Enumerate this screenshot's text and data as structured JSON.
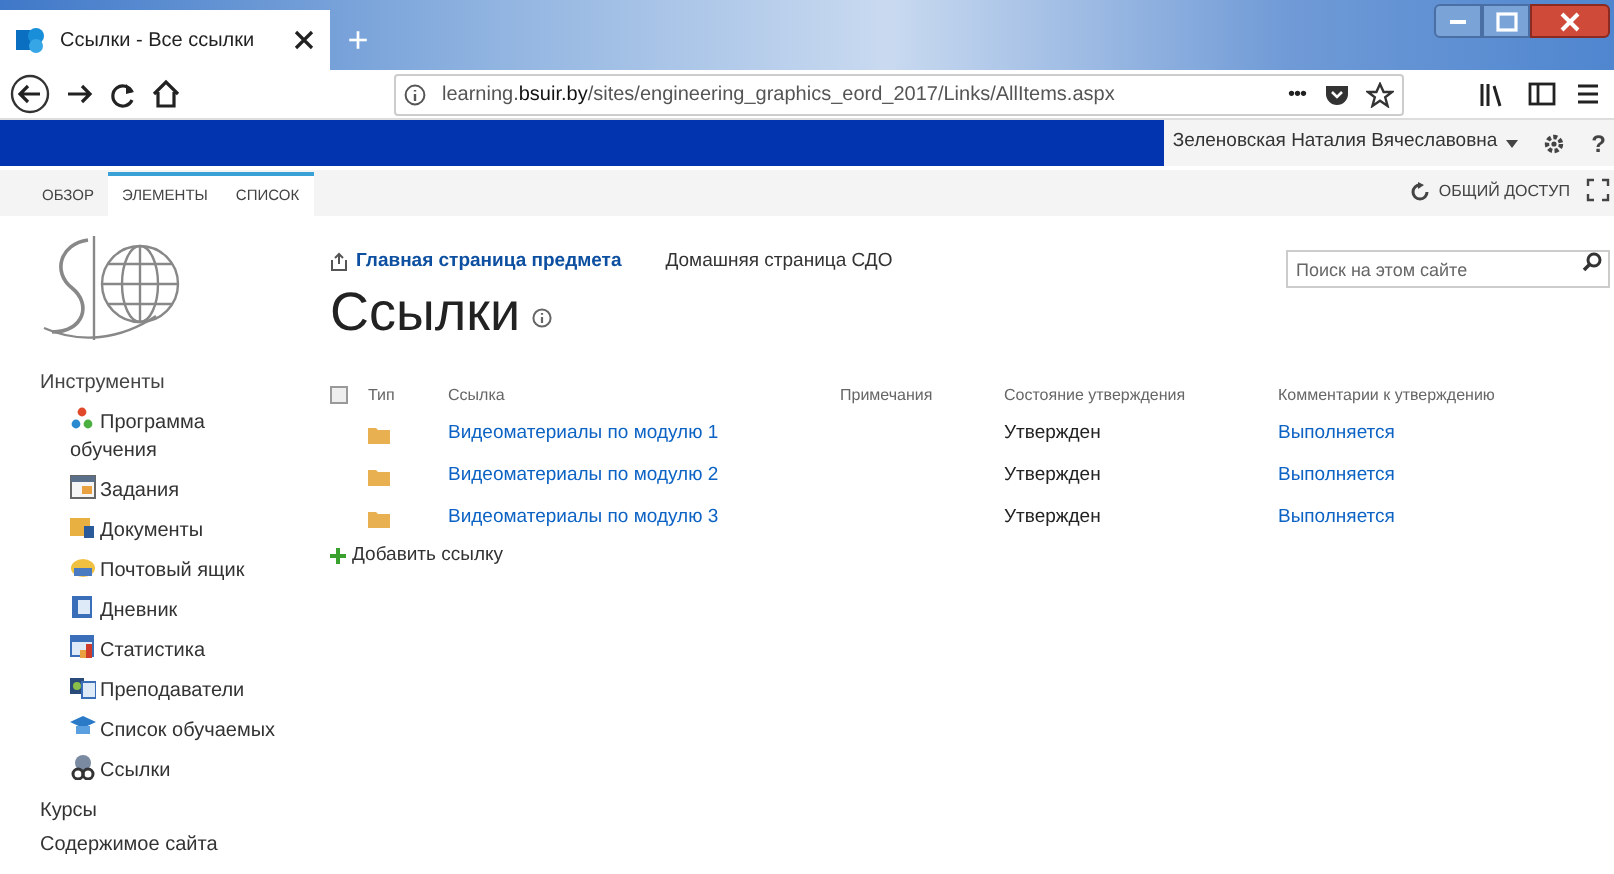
{
  "browser": {
    "tabs": [
      {
        "title": "Ссылки - Все ссылки",
        "selected": true
      }
    ],
    "new_tab": "+",
    "url_prefix": "learning.",
    "url_domain": "bsuir.by",
    "url_path": "/sites/engineering_graphics_eord_2017/Links/AllItems.aspx",
    "page_actions": "•••"
  },
  "suite_bar": {
    "user": "Зеленовская Наталия Вячеславовна",
    "help": "?"
  },
  "ribbon": {
    "tabs": [
      {
        "label": "ОБЗОР",
        "selected": false,
        "contextual": false
      },
      {
        "label": "ЭЛЕМЕНТЫ",
        "selected": false,
        "contextual": true
      },
      {
        "label": "СПИСОК",
        "selected": false,
        "contextual": true
      }
    ],
    "share": "ОБЩИЙ ДОСТУП"
  },
  "top_nav": [
    {
      "label": "Главная страница предмета",
      "kind": "home"
    },
    {
      "label": "Домашняя страница СДО",
      "kind": "plain"
    }
  ],
  "search": {
    "placeholder": "Поиск на этом сайте"
  },
  "page_title": "Ссылки",
  "sidebar": {
    "heading": "Инструменты",
    "items": [
      {
        "label": "Программа обучения"
      },
      {
        "label": "Задания"
      },
      {
        "label": "Документы"
      },
      {
        "label": "Почтовый ящик"
      },
      {
        "label": "Дневник"
      },
      {
        "label": "Статистика"
      },
      {
        "label": "Преподаватели"
      },
      {
        "label": "Список обучаемых"
      },
      {
        "label": "Ссылки"
      }
    ],
    "links": [
      "Курсы",
      "Содержимое сайта"
    ]
  },
  "table": {
    "select_all": {
      "checked": false
    },
    "columns": [
      "Тип",
      "Ссылка",
      "Примечания",
      "Состояние утверждения",
      "Комментарии к утверждению"
    ],
    "rows": [
      {
        "link": "Видеоматериалы по модулю 1",
        "status": "Утвержден",
        "comment": "Выполняется"
      },
      {
        "link": "Видеоматериалы по модулю 2",
        "status": "Утвержден",
        "comment": "Выполняется"
      },
      {
        "link": "Видеоматериалы по модулю 3",
        "status": "Утвержден",
        "comment": "Выполняется"
      }
    ]
  },
  "add_link": "Добавить ссылку"
}
